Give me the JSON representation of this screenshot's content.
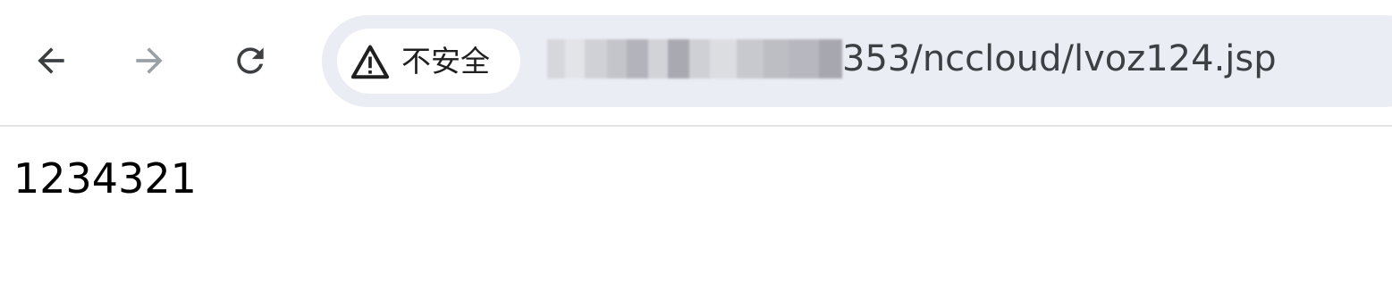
{
  "toolbar": {
    "back_icon": "arrow-left-icon",
    "forward_icon": "arrow-right-icon",
    "reload_icon": "reload-icon"
  },
  "address_bar": {
    "security_icon": "warning-triangle-icon",
    "security_label": "不安全",
    "url_visible": "353/nccloud/lvoz124.jsp",
    "url_redacted": true
  },
  "page": {
    "body_text": "1234321"
  },
  "colors": {
    "omnibox_bg": "#ebedf5",
    "chip_bg": "#ffffff",
    "icon_active": "#3c4043",
    "icon_disabled": "#9aa0a6"
  }
}
